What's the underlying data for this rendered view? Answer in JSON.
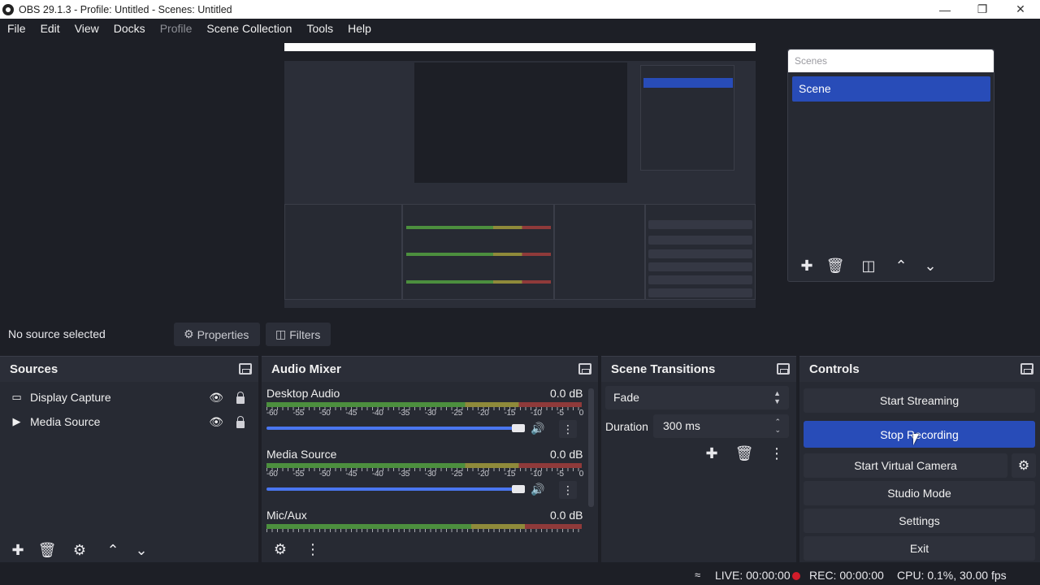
{
  "window": {
    "title": "OBS 29.1.3 - Profile: Untitled - Scenes: Untitled"
  },
  "menubar": [
    {
      "label": "File"
    },
    {
      "label": "Edit"
    },
    {
      "label": "View"
    },
    {
      "label": "Docks"
    },
    {
      "label": "Profile"
    },
    {
      "label": "Scene Collection"
    },
    {
      "label": "Tools"
    },
    {
      "label": "Help"
    }
  ],
  "scenes": {
    "header": "Scenes",
    "items": [
      {
        "label": "Scene",
        "selected": true
      }
    ]
  },
  "infobar": {
    "no_source": "No source selected",
    "properties": "Properties",
    "filters": "Filters"
  },
  "sources": {
    "title": "Sources",
    "items": [
      {
        "label": "Display Capture",
        "icon": "monitor-icon"
      },
      {
        "label": "Media Source",
        "icon": "play-icon"
      }
    ]
  },
  "mixer": {
    "title": "Audio Mixer",
    "scale": [
      "-60",
      "-55",
      "-50",
      "-45",
      "-40",
      "-35",
      "-30",
      "-25",
      "-20",
      "-15",
      "-10",
      "-5",
      "0"
    ],
    "channels": [
      {
        "name": "Desktop Audio",
        "level": "0.0 dB",
        "volume": 1.0
      },
      {
        "name": "Media Source",
        "level": "0.0 dB",
        "volume": 1.0
      },
      {
        "name": "Mic/Aux",
        "level": "0.0 dB",
        "volume": 1.0
      }
    ]
  },
  "transitions": {
    "title": "Scene Transitions",
    "selected": "Fade",
    "duration_label": "Duration",
    "duration_value": "300 ms"
  },
  "controls": {
    "title": "Controls",
    "start_streaming": "Start Streaming",
    "stop_recording": "Stop Recording",
    "start_virtual_camera": "Start Virtual Camera",
    "studio_mode": "Studio Mode",
    "settings": "Settings",
    "exit": "Exit"
  },
  "status": {
    "live": "LIVE: 00:00:00",
    "rec": "REC: 00:00:00",
    "cpu": "CPU: 0.1%, 30.00 fps"
  },
  "colors": {
    "accent": "#284cb8",
    "rec": "#d11c2a",
    "background": "#1d1f26"
  }
}
